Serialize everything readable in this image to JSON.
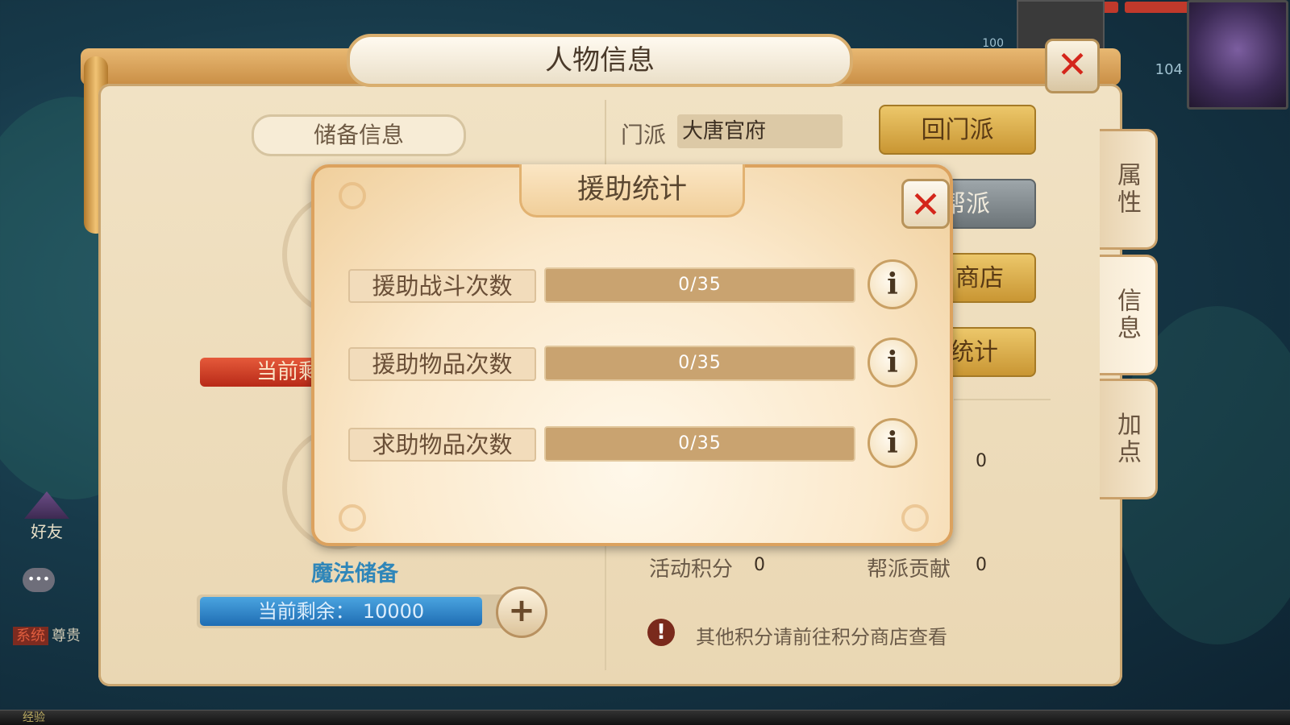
{
  "hud": {
    "level_main": "104",
    "level_partner": "100"
  },
  "sidebar": {
    "friend_label": "好友",
    "system_tag": "系统",
    "system_text": "尊贵",
    "exp_label": "经验"
  },
  "main_panel": {
    "title": "人物信息",
    "reserve_section": "储备信息",
    "red_bar_partial": "当前剩",
    "magic_reserve_label": "魔法储备",
    "mana_prefix": "当前剩余：",
    "mana_value": "10000",
    "sect_label": "门派",
    "sect_value": "大唐官府",
    "buttons": {
      "return_sect": "回门派",
      "gang_partial": "帮派",
      "shop_partial": "商店",
      "stats_partial": "统计"
    },
    "tabs": {
      "attributes": "属性",
      "info": "信息",
      "add_points": "加点"
    },
    "value_right": "0",
    "activity_points_label": "活动积分",
    "activity_points_value": "0",
    "gang_contribution_label": "帮派贡献",
    "gang_contribution_value": "0",
    "notice": "其他积分请前往积分商店查看"
  },
  "modal": {
    "title": "援助统计",
    "rows": [
      {
        "label": "援助战斗次数",
        "current": 0,
        "max": 35,
        "display": "0/35"
      },
      {
        "label": "援助物品次数",
        "current": 0,
        "max": 35,
        "display": "0/35"
      },
      {
        "label": "求助物品次数",
        "current": 0,
        "max": 35,
        "display": "0/35"
      }
    ]
  },
  "colors": {
    "accent_gold": "#c99633",
    "close_red": "#d4261b",
    "mana_blue": "#1f6db3",
    "bar_track": "#c9a370"
  },
  "icons": {
    "close": "close-icon",
    "info": "info-icon",
    "plus": "plus-icon",
    "notice": "exclamation-icon"
  }
}
